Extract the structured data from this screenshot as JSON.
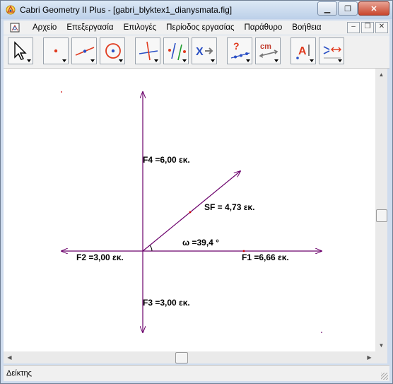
{
  "window": {
    "title": "Cabri Geometry II Plus - [gabri_blyktex1_dianysmata.fig]",
    "minimize_glyph": "▁",
    "restore_glyph": "❐",
    "close_glyph": "✕"
  },
  "menu": {
    "items": [
      "Αρχείο",
      "Επεξεργασία",
      "Επιλογές",
      "Περίοδος εργασίας",
      "Παράθυρο",
      "Βοήθεια"
    ],
    "mdi_min": "–",
    "mdi_restore": "❐",
    "mdi_close": "✕"
  },
  "toolbar": {
    "tools": [
      {
        "icon": "pointer-icon"
      },
      {
        "icon": "point-icon"
      },
      {
        "icon": "line-icon"
      },
      {
        "icon": "circle-icon"
      },
      {
        "icon": "construct-icon"
      },
      {
        "icon": "transform-icon"
      },
      {
        "icon": "macro-icon"
      },
      {
        "icon": "check-property-icon"
      },
      {
        "icon": "measure-icon"
      },
      {
        "icon": "display-icon"
      },
      {
        "icon": "draw-icon"
      }
    ],
    "cm_text": "cm",
    "question_text": "?",
    "x_text": "X",
    "a_text": "A"
  },
  "canvas": {
    "labels": {
      "f4": "F4 =6,00 εκ.",
      "sf": "SF = 4,73 εκ.",
      "omega": "ω =39,4 °",
      "f2": "F2 =3,00 εκ.",
      "f1": "F1 =6,66 εκ.",
      "f3": "F3 =3,00 εκ."
    },
    "colors": {
      "vector": "#6b006b",
      "point": "#cc0000"
    }
  },
  "scrollbars": {
    "up": "▲",
    "down": "▼",
    "left": "◀",
    "right": "▶"
  },
  "status": {
    "text": "Δείκτης"
  }
}
